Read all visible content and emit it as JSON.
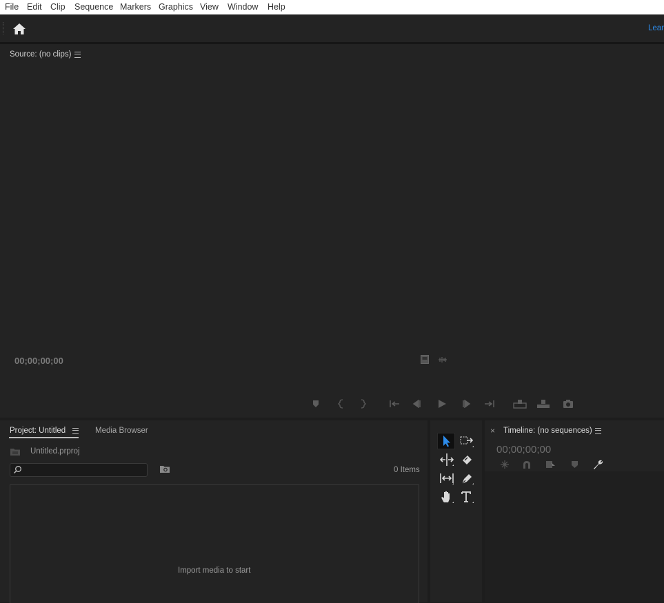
{
  "menu": [
    "File",
    "Edit",
    "Clip",
    "Sequence",
    "Markers",
    "Graphics",
    "View",
    "Window",
    "Help"
  ],
  "header": {
    "learn": "Lear"
  },
  "source": {
    "title": "Source: (no clips)",
    "timecode": "00;00;00;00"
  },
  "project": {
    "tab": "Project: Untitled",
    "media_tab": "Media Browser",
    "file": "Untitled.prproj",
    "items": "0 Items",
    "empty": "Import media to start"
  },
  "timeline": {
    "title": "Timeline: (no sequences)",
    "close": "×",
    "timecode": "00;00;00;00"
  },
  "colors": {
    "accent": "#2d8ceb",
    "panel": "#232323",
    "bg": "#1d1d1d"
  }
}
